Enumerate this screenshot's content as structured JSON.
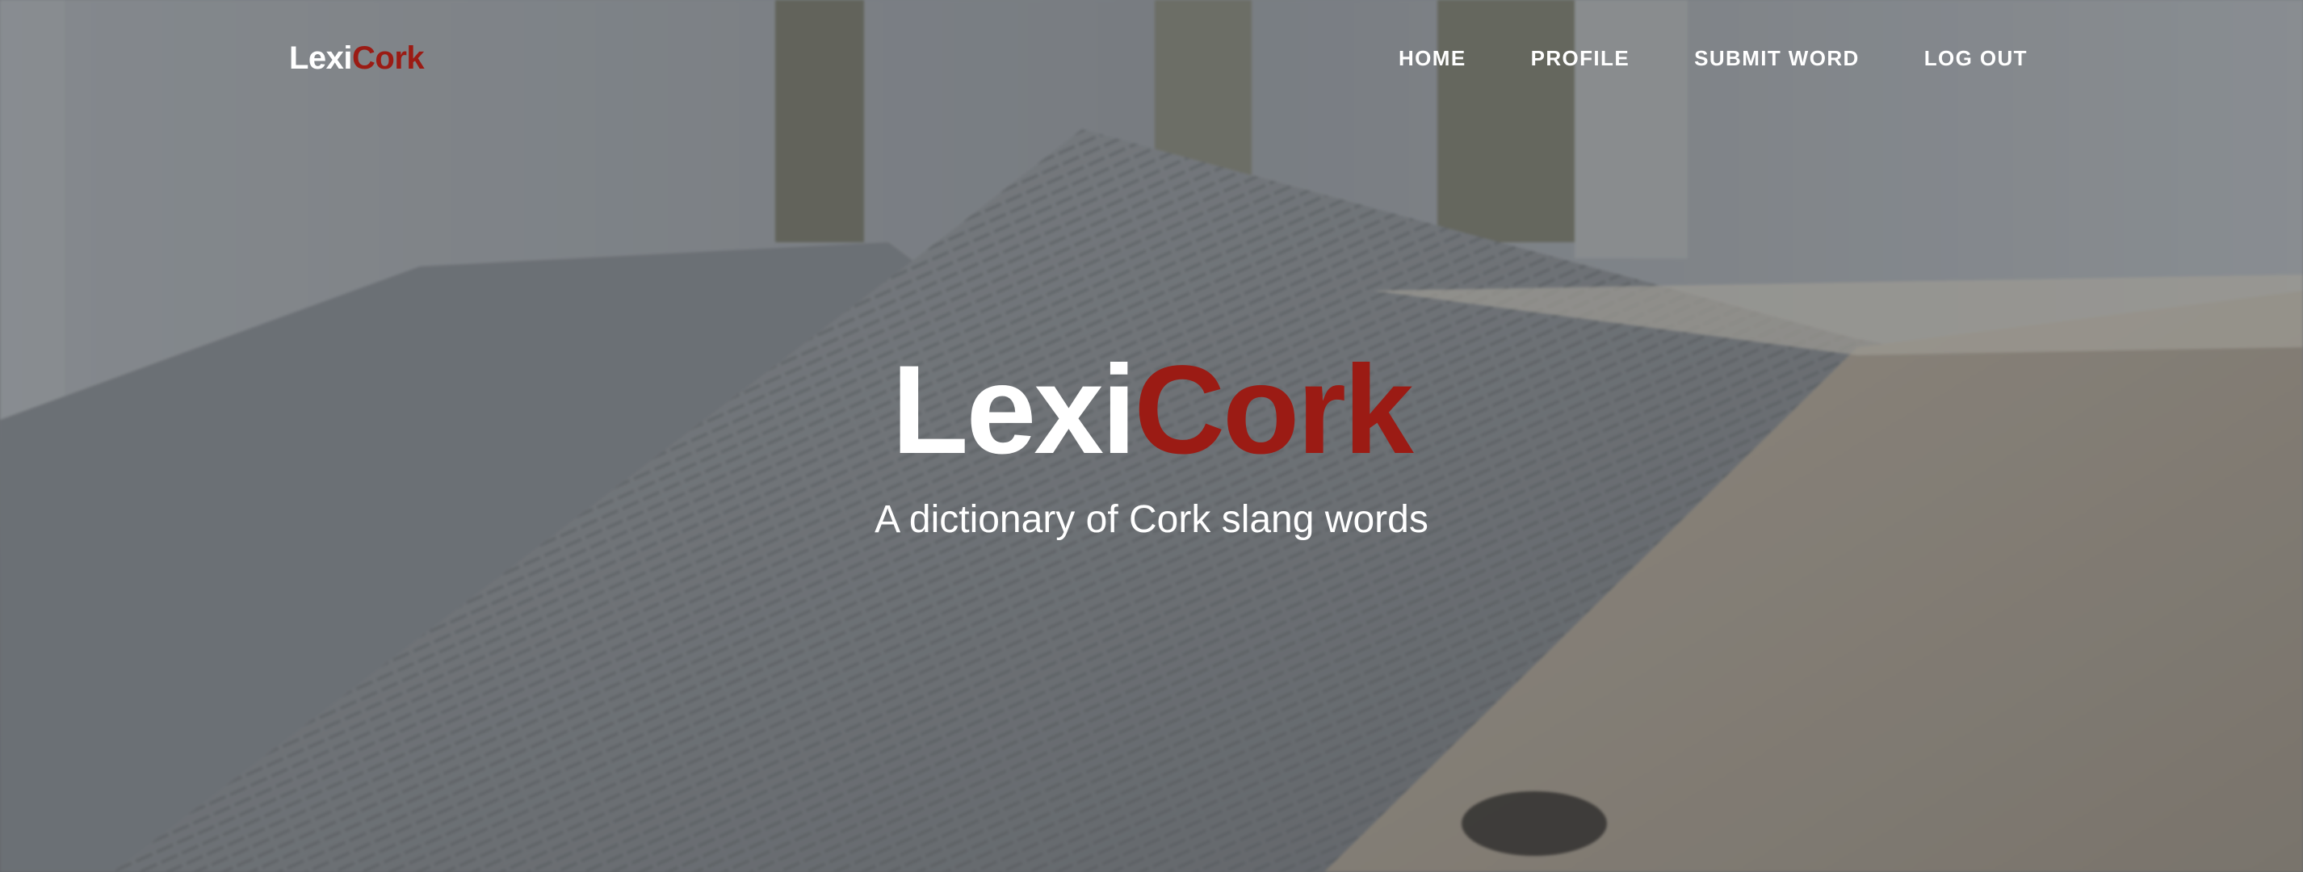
{
  "navbar": {
    "brand_primary": "Lexi",
    "brand_accent": "Cork",
    "links": [
      {
        "label": "HOME"
      },
      {
        "label": "PROFILE"
      },
      {
        "label": "SUBMIT WORD"
      },
      {
        "label": "LOG OUT"
      }
    ]
  },
  "hero": {
    "title_primary": "Lexi",
    "title_accent": "Cork",
    "subtitle": "A dictionary of Cork slang words",
    "background_image": "open-dictionary-photo"
  },
  "colors": {
    "accent": "#9b1b14",
    "text": "#ffffff",
    "overlay": "#5f6368"
  }
}
